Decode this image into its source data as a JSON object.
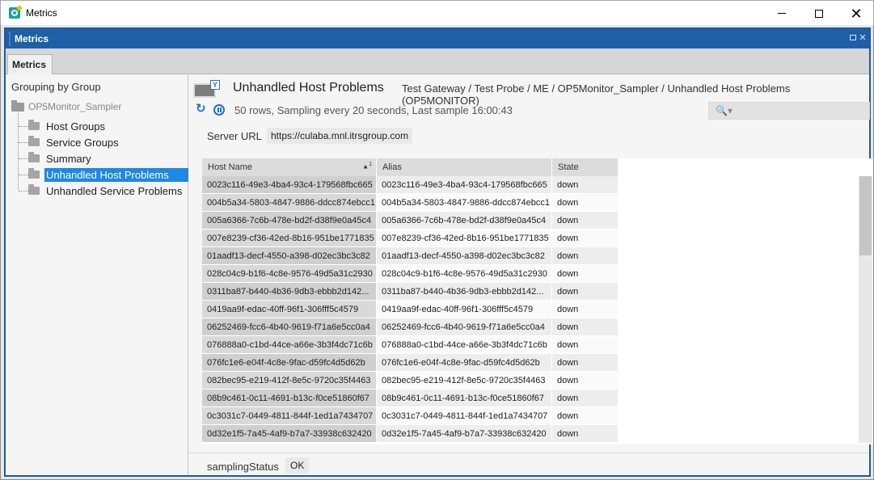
{
  "window": {
    "title": "Metrics"
  },
  "panel": {
    "title": "Metrics",
    "tab": "Metrics"
  },
  "tree": {
    "heading": "Grouping by Group",
    "root": "OP5Monitor_Sampler",
    "items": [
      {
        "label": "Host Groups",
        "selected": false
      },
      {
        "label": "Service Groups",
        "selected": false
      },
      {
        "label": "Summary",
        "selected": false
      },
      {
        "label": "Unhandled Host Problems",
        "selected": true
      },
      {
        "label": "Unhandled Service Problems",
        "selected": false
      }
    ]
  },
  "view": {
    "title": "Unhandled Host Problems",
    "path": "Test Gateway / Test Probe / ME / OP5Monitor_Sampler / Unhandled Host Problems (OP5MONITOR)",
    "status": "50 rows, Sampling every 20 seconds, Last sample 16:00:43",
    "server_url_label": "Server URL",
    "server_url_value": "https://culaba.mnl.itrsgroup.com"
  },
  "table": {
    "columns": [
      "Host Name",
      "Alias",
      "State"
    ],
    "sort_indicator": "1",
    "rows": [
      [
        "0023c116-49e3-4ba4-93c4-179568fbc665",
        "0023c116-49e3-4ba4-93c4-179568fbc665",
        "down"
      ],
      [
        "004b5a34-5803-4847-9886-ddcc874ebcc1",
        "004b5a34-5803-4847-9886-ddcc874ebcc1",
        "down"
      ],
      [
        "005a6366-7c6b-478e-bd2f-d38f9e0a45c4",
        "005a6366-7c6b-478e-bd2f-d38f9e0a45c4",
        "down"
      ],
      [
        "007e8239-cf36-42ed-8b16-951be1771835",
        "007e8239-cf36-42ed-8b16-951be1771835",
        "down"
      ],
      [
        "01aadf13-decf-4550-a398-d02ec3bc3c82",
        "01aadf13-decf-4550-a398-d02ec3bc3c82",
        "down"
      ],
      [
        "028c04c9-b1f6-4c8e-9576-49d5a31c2930",
        "028c04c9-b1f6-4c8e-9576-49d5a31c2930",
        "down"
      ],
      [
        "0311ba87-b440-4b36-9db3-ebbb2d142...",
        "0311ba87-b440-4b36-9db3-ebbb2d142...",
        "down"
      ],
      [
        "0419aa9f-edac-40ff-96f1-306fff5c4579",
        "0419aa9f-edac-40ff-96f1-306fff5c4579",
        "down"
      ],
      [
        "06252469-fcc6-4b40-9619-f71a6e5cc0a4",
        "06252469-fcc6-4b40-9619-f71a6e5cc0a4",
        "down"
      ],
      [
        "076888a0-c1bd-44ce-a66e-3b3f4dc71c6b",
        "076888a0-c1bd-44ce-a66e-3b3f4dc71c6b",
        "down"
      ],
      [
        "076fc1e6-e04f-4c8e-9fac-d59fc4d5d62b",
        "076fc1e6-e04f-4c8e-9fac-d59fc4d5d62b",
        "down"
      ],
      [
        "082bec95-e219-412f-8e5c-9720c35f4463",
        "082bec95-e219-412f-8e5c-9720c35f4463",
        "down"
      ],
      [
        "08b9c461-0c11-4691-b13c-f0ce51860f67",
        "08b9c461-0c11-4691-b13c-f0ce51860f67",
        "down"
      ],
      [
        "0c3031c7-0449-4811-844f-1ed1a7434707",
        "0c3031c7-0449-4811-844f-1ed1a7434707",
        "down"
      ],
      [
        "0d32e1f5-7a45-4af9-b7a7-33938c632420",
        "0d32e1f5-7a45-4af9-b7a7-33938c632420",
        "down"
      ]
    ]
  },
  "bottom": {
    "label": "samplingStatus",
    "value": "OK"
  },
  "icons": {
    "app": "geneos-app-icon",
    "refresh": "refresh-icon",
    "pause": "pause-icon",
    "search": "search-icon",
    "filter": "filter-icon"
  },
  "colors": {
    "panel_header": "#1f5fa7",
    "selection": "#1e88e5",
    "accent": "#1e6fd0"
  }
}
